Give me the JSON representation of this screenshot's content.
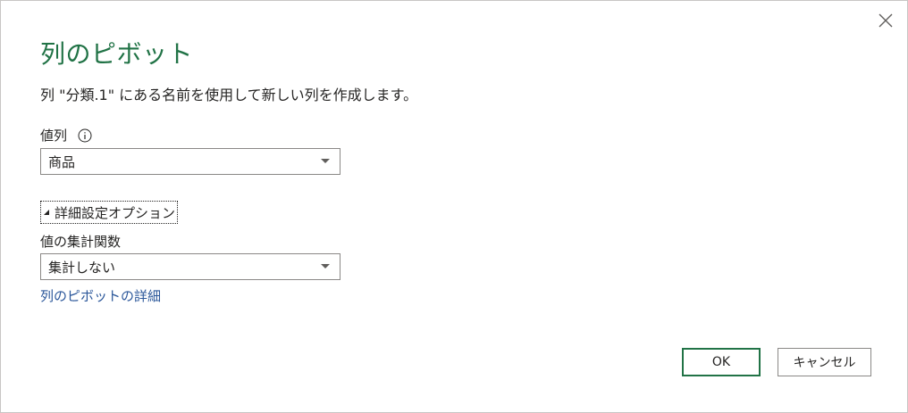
{
  "dialog": {
    "title": "列のピボット",
    "description": "列 \"分類.1\" にある名前を使用して新しい列を作成します。",
    "close_icon": "close-icon"
  },
  "value_column": {
    "label": "値列",
    "info_icon": "info-icon",
    "selected": "商品"
  },
  "advanced": {
    "toggle_label": "詳細設定オプション",
    "aggregate_label": "値の集計関数",
    "aggregate_selected": "集計しない"
  },
  "help_link": "列のピボットの詳細",
  "buttons": {
    "ok": "OK",
    "cancel": "キャンセル"
  },
  "colors": {
    "title": "#217346",
    "link": "#2b579a",
    "ok_border": "#217346"
  }
}
